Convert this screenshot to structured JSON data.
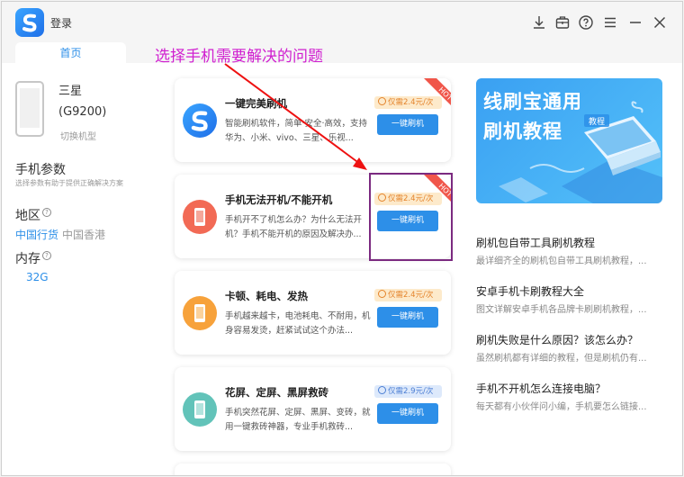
{
  "titlebar": {
    "login_label": "登录",
    "home_tab": "首页",
    "icons": [
      "download-icon",
      "briefcase-icon",
      "help-icon",
      "menu-icon",
      "minimize-icon",
      "close-icon"
    ]
  },
  "annotation": "选择手机需要解决的问题",
  "device": {
    "brand": "三星",
    "model": "(G9200)",
    "switch_label": "切换机型"
  },
  "params": {
    "title": "手机参数",
    "desc": "选择参数有助于提供正确解决方案",
    "region_label": "地区",
    "regions": [
      "中国行货",
      "中国香港"
    ],
    "memory_label": "内存",
    "memory_value": "32G"
  },
  "cards": [
    {
      "title": "一键完美刷机",
      "desc": "智能刷机软件，简单·安全·高效，支持华为、小米、vivo、三星、乐视...",
      "price": "仅需2.4元/次",
      "button": "一键刷机",
      "hot": "HOT",
      "icon": "app-logo-icon"
    },
    {
      "title": "手机无法开机/不能开机",
      "desc": "手机开不了机怎么办？为什么无法开机？手机不能开机的原因及解决办...",
      "price": "仅需2.4元/次",
      "button": "一键刷机",
      "hot": "HOT",
      "icon": "phone-icon"
    },
    {
      "title": "卡顿、耗电、发热",
      "desc": "手机越来越卡，电池耗电、不耐用，机身容易发烫，赶紧试试这个办法...",
      "price": "仅需2.4元/次",
      "button": "一键刷机",
      "icon": "phone-icon"
    },
    {
      "title": "花屏、定屏、黑屏救砖",
      "desc": "手机突然花屏、定屏、黑屏、变砖，就用一键救砖神器，专业手机救砖...",
      "price": "仅需2.9元/次",
      "button": "一键刷机",
      "icon": "phone-icon"
    }
  ],
  "banner": {
    "line1": "线刷宝通用",
    "line2": "刷机教程",
    "tag": "教程"
  },
  "tutorials": [
    {
      "title": "刷机包自带工具刷机教程",
      "desc": "最详细齐全的刷机包自带工具刷机教程，..."
    },
    {
      "title": "安卓手机卡刷教程大全",
      "desc": "图文详解安卓手机各品牌卡刷刷机教程，..."
    },
    {
      "title": "刷机失败是什么原因？该怎么办？",
      "desc": "虽然刷机都有详细的教程，但是刷机仍有..."
    },
    {
      "title": "手机不开机怎么连接电脑？",
      "desc": "每天都有小伙伴问小编，手机要怎么链接..."
    }
  ],
  "colors": {
    "accent": "#2d8fe8",
    "annotation": "#d01fd0",
    "hot": "#f0564a",
    "orange_icon": "#f7a23b",
    "red_icon": "#f26a55",
    "teal_icon": "#62c3b9"
  }
}
